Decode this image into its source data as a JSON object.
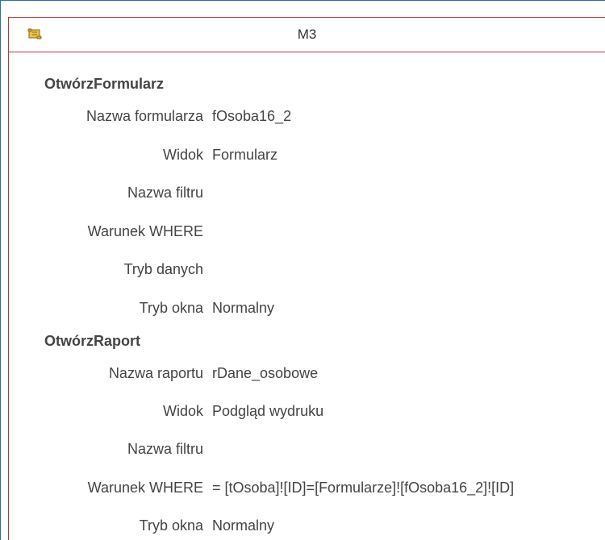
{
  "window": {
    "title": "M3",
    "icon": "macro-scroll-icon"
  },
  "actions": [
    {
      "name": "OtwórzFormularz",
      "arguments": [
        {
          "label": "Nazwa formularza",
          "value": "fOsoba16_2"
        },
        {
          "label": "Widok",
          "value": "Formularz"
        },
        {
          "label": "Nazwa filtru",
          "value": ""
        },
        {
          "label": "Warunek WHERE",
          "value": ""
        },
        {
          "label": "Tryb danych",
          "value": ""
        },
        {
          "label": "Tryb okna",
          "value": "Normalny"
        }
      ]
    },
    {
      "name": "OtwórzRaport",
      "arguments": [
        {
          "label": "Nazwa raportu",
          "value": "rDane_osobowe"
        },
        {
          "label": "Widok",
          "value": "Podgląd wydruku"
        },
        {
          "label": "Nazwa filtru",
          "value": ""
        },
        {
          "label": "Warunek WHERE",
          "value": "= [tOsoba]![ID]=[Formularze]![fOsoba16_2]![ID]"
        },
        {
          "label": "Tryb okna",
          "value": "Normalny"
        }
      ]
    }
  ],
  "colors": {
    "window_border": "#2b6cb5",
    "tab_border": "#b23a3a",
    "text": "#444444"
  }
}
